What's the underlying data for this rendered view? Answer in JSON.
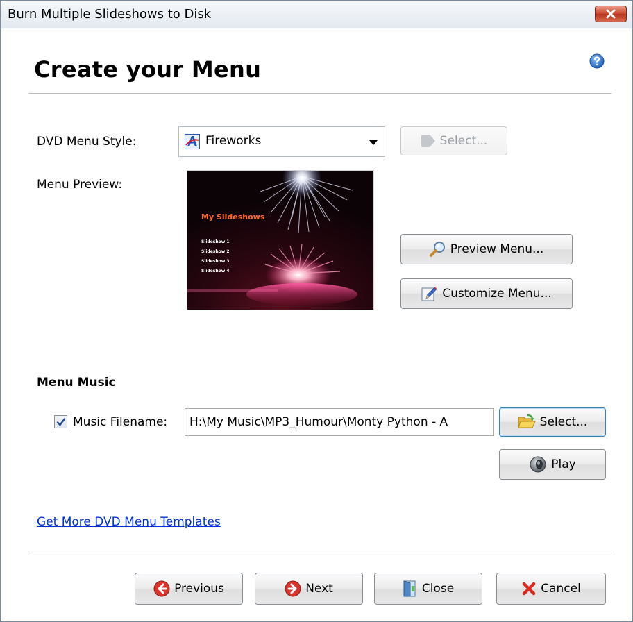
{
  "window": {
    "title": "Burn Multiple Slideshows to Disk",
    "close_icon": "close-x-icon"
  },
  "page": {
    "heading": "Create your Menu",
    "help_icon": "help-question-icon"
  },
  "menu_style": {
    "label": "DVD Menu Style:",
    "selected": "Fireworks",
    "select_button": "Select...",
    "select_enabled": false
  },
  "menu_preview": {
    "label": "Menu Preview:",
    "image_title": "My Slideshows",
    "image_items": [
      "Slideshow 1",
      "Slideshow 2",
      "Slideshow 3",
      "Slideshow 4"
    ],
    "preview_button": "Preview Menu...",
    "customize_button": "Customize Menu..."
  },
  "menu_music": {
    "section_title": "Menu Music",
    "checkbox_checked": true,
    "filename_label": "Music Filename:",
    "filename_value": "H:\\My Music\\MP3_Humour\\Monty Python - A",
    "select_button": "Select...",
    "play_button": "Play"
  },
  "links": {
    "more_templates": "Get More DVD Menu Templates"
  },
  "footer": {
    "previous": "Previous",
    "next": "Next",
    "close": "Close",
    "cancel": "Cancel"
  },
  "colors": {
    "link": "#0033cc",
    "close_button": "#c9452c",
    "nav_icon": "#d9342b"
  }
}
